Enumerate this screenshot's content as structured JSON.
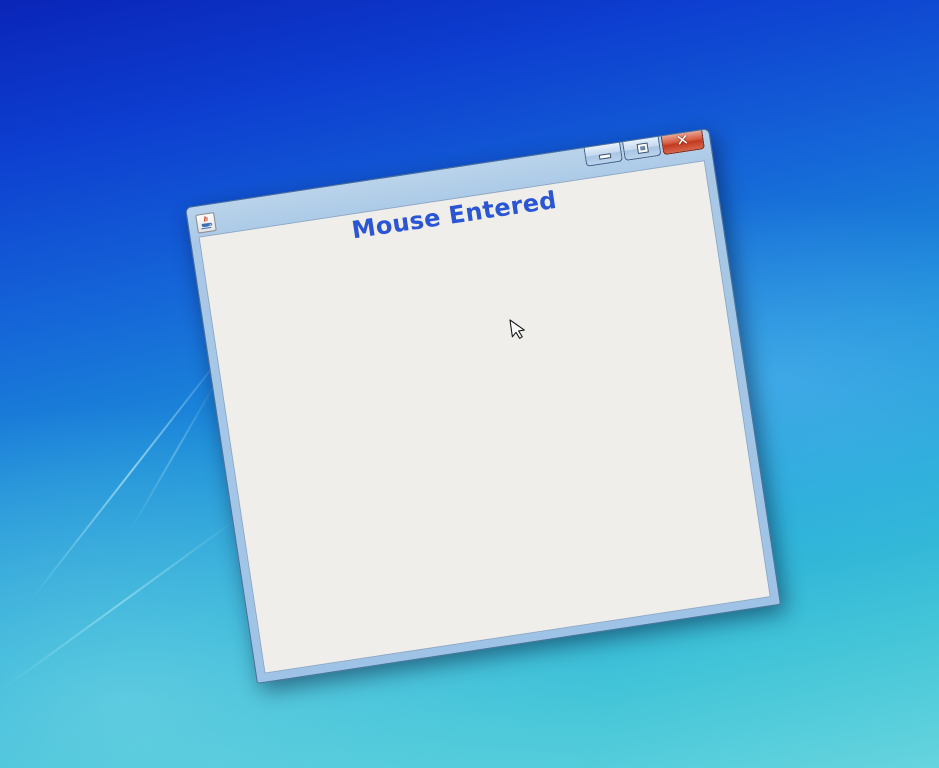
{
  "desktop": {
    "background_colors": [
      "#0a25b8",
      "#1d8fd9",
      "#66d4de"
    ]
  },
  "window": {
    "title": "",
    "app_icon": "java-icon",
    "controls": {
      "minimize_icon": "minimize-icon",
      "maximize_icon": "maximize-icon",
      "close_icon": "close-icon",
      "close_glyph": "✕"
    },
    "close_color": "#c13a20"
  },
  "content": {
    "status_text": "Mouse Entered",
    "status_color": "#2a55d4"
  },
  "pointer": {
    "icon": "arrow-cursor-icon"
  }
}
